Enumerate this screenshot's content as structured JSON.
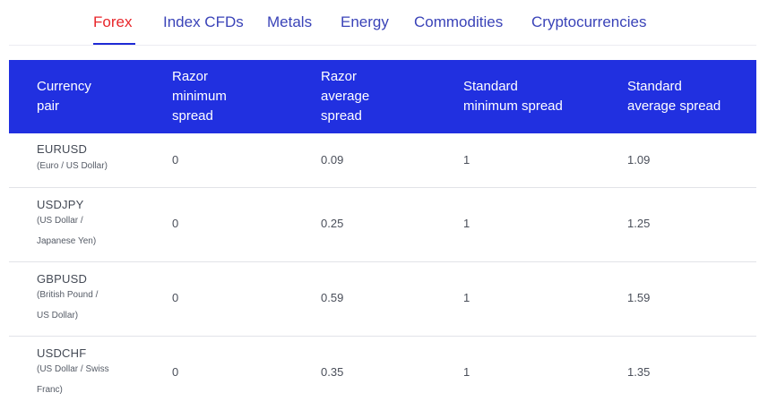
{
  "tabs": [
    {
      "label": "Forex",
      "active": true
    },
    {
      "label": "Index CFDs",
      "active": false
    },
    {
      "label": "Metals",
      "active": false
    },
    {
      "label": "Energy",
      "active": false
    },
    {
      "label": "Commodities",
      "active": false
    },
    {
      "label": "Cryptocurrencies",
      "active": false
    }
  ],
  "table": {
    "headers": [
      "Currency\npair",
      "Razor\nminimum\nspread",
      "Razor\naverage\nspread",
      "Standard\nminimum spread",
      "Standard\naverage spread"
    ],
    "rows": [
      {
        "pair": "EURUSD",
        "name": "(Euro / US Dollar)",
        "razor_min": "0",
        "razor_avg": "0.09",
        "std_min": "1",
        "std_avg": "1.09"
      },
      {
        "pair": "USDJPY",
        "name": "(US Dollar /\nJapanese Yen)",
        "razor_min": "0",
        "razor_avg": "0.25",
        "std_min": "1",
        "std_avg": "1.25"
      },
      {
        "pair": "GBPUSD",
        "name": "(British Pound /\nUS Dollar)",
        "razor_min": "0",
        "razor_avg": "0.59",
        "std_min": "1",
        "std_avg": "1.59"
      },
      {
        "pair": "USDCHF",
        "name": "(US Dollar / Swiss\nFranc)",
        "razor_min": "0",
        "razor_avg": "0.35",
        "std_min": "1",
        "std_avg": "1.35"
      }
    ]
  },
  "colors": {
    "header_bg": "#2130e0",
    "active_tab": "#e8262b",
    "tab": "#3a43b8"
  }
}
